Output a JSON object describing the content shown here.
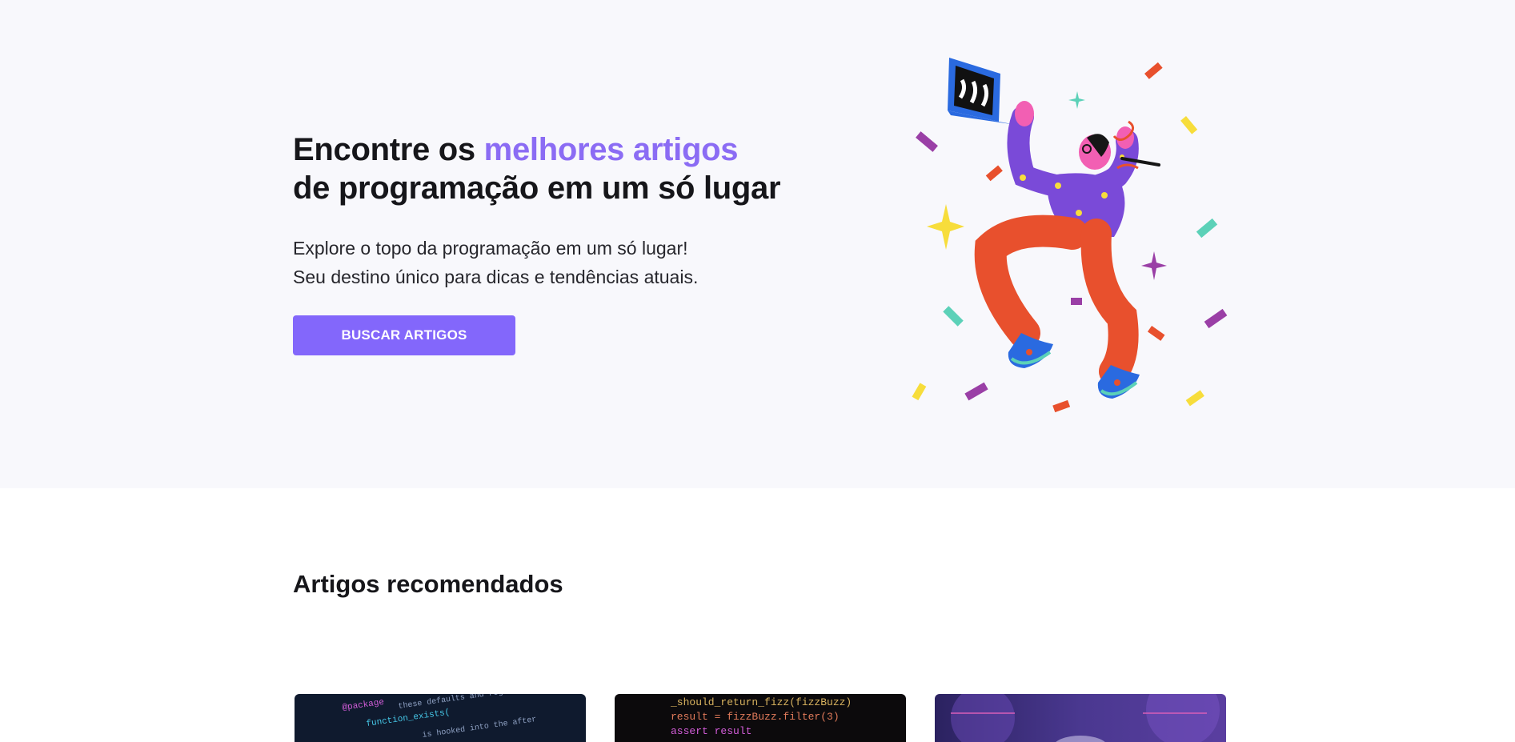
{
  "hero": {
    "title_line1_plain": "Encontre os ",
    "title_line1_accent": "melhores artigos",
    "title_line2": "de programação em um só lugar",
    "subtitle_line1": "Explore o topo da programação em um só lugar!",
    "subtitle_line2": "Seu destino único para dicas e tendências atuais.",
    "button_label": "BUSCAR ARTIGOS",
    "accent_color": "#8b6cf4",
    "button_color": "#8367fb",
    "illustration": "person-jumping-with-laptop-confetti"
  },
  "recommended": {
    "title": "Artigos recomendados",
    "cards": [
      {
        "image": "code-editor-dark-blue",
        "code_snippet": "function_exists("
      },
      {
        "image": "code-editor-black",
        "code_line1": "result = fizzBuzz.filter(3)",
        "code_line2": "assert result"
      },
      {
        "image": "purple-abstract-tech"
      }
    ]
  }
}
